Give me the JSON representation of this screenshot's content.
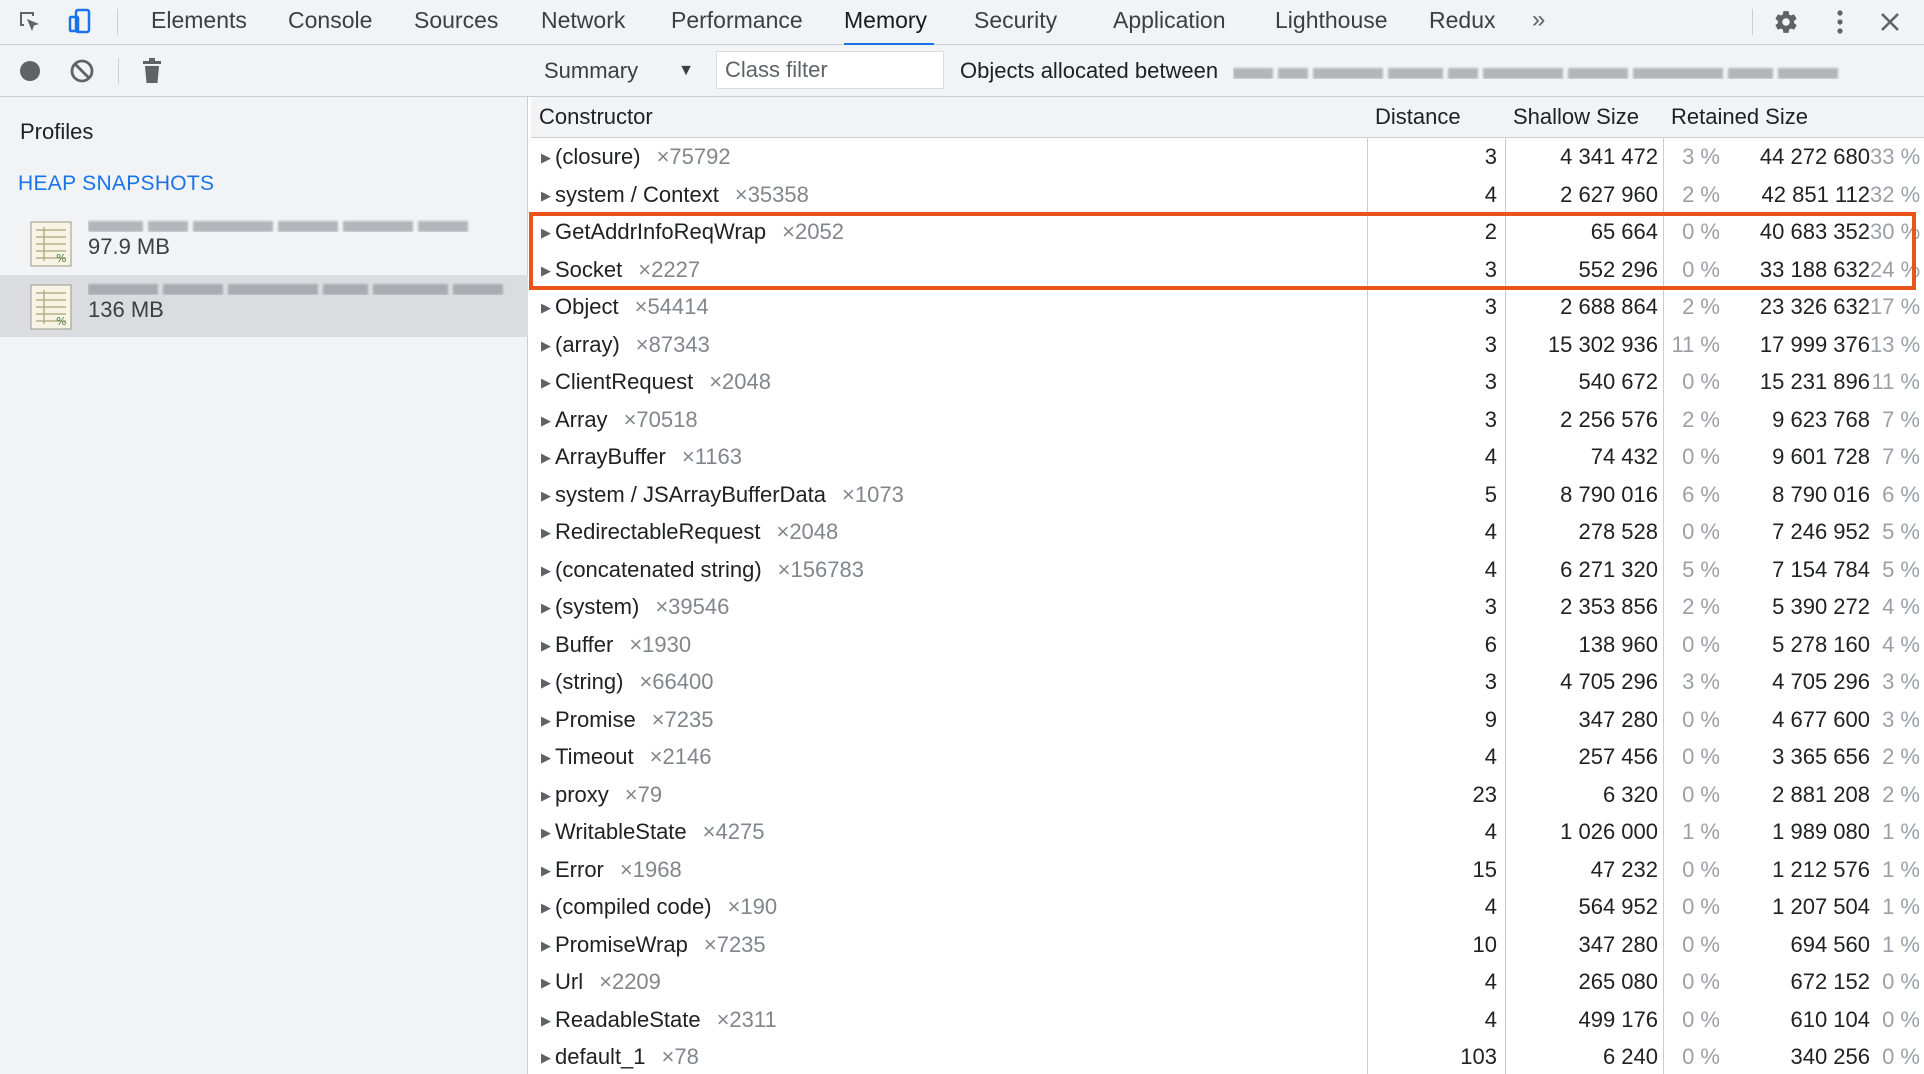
{
  "tabs": [
    {
      "label": "Elements",
      "active": false
    },
    {
      "label": "Console",
      "active": false
    },
    {
      "label": "Sources",
      "active": false
    },
    {
      "label": "Network",
      "active": false
    },
    {
      "label": "Performance",
      "active": false
    },
    {
      "label": "Memory",
      "active": true
    },
    {
      "label": "Security",
      "active": false
    },
    {
      "label": "Application",
      "active": false
    },
    {
      "label": "Lighthouse",
      "active": false
    },
    {
      "label": "Redux",
      "active": false
    }
  ],
  "more_tabs": "»",
  "colors": {
    "accent": "#1a73e8",
    "highlight": "#e8541a"
  },
  "icons": [
    "inspect-element-icon",
    "device-toolbar-icon",
    "record-icon",
    "clear-icon",
    "trash-icon",
    "settings-gear-icon",
    "kebab-menu-icon",
    "close-icon",
    "chevron-right-icon"
  ],
  "sidebar": {
    "title": "Profiles",
    "section": "HEAP SNAPSHOTS",
    "snapshots": [
      {
        "size": "97.9 MB",
        "selected": false
      },
      {
        "size": "136 MB",
        "selected": true
      }
    ]
  },
  "toolbar": {
    "view": "Summary",
    "view_arrow": "▼",
    "class_filter_placeholder": "Class filter",
    "allocated_label": "Objects allocated between"
  },
  "table": {
    "headers": {
      "constructor": "Constructor",
      "distance": "Distance",
      "shallow": "Shallow Size",
      "retained": "Retained Size"
    },
    "rows": [
      {
        "name": "(closure)",
        "count": "×75792",
        "distance": "3",
        "shallow": "4 341 472",
        "shallow_pct": "3 %",
        "retained": "44 272 680",
        "retained_pct": "33 %"
      },
      {
        "name": "system / Context",
        "count": "×35358",
        "distance": "4",
        "shallow": "2 627 960",
        "shallow_pct": "2 %",
        "retained": "42 851 112",
        "retained_pct": "32 %"
      },
      {
        "name": "GetAddrInfoReqWrap",
        "count": "×2052",
        "distance": "2",
        "shallow": "65 664",
        "shallow_pct": "0 %",
        "retained": "40 683 352",
        "retained_pct": "30 %"
      },
      {
        "name": "Socket",
        "count": "×2227",
        "distance": "3",
        "shallow": "552 296",
        "shallow_pct": "0 %",
        "retained": "33 188 632",
        "retained_pct": "24 %"
      },
      {
        "name": "Object",
        "count": "×54414",
        "distance": "3",
        "shallow": "2 688 864",
        "shallow_pct": "2 %",
        "retained": "23 326 632",
        "retained_pct": "17 %"
      },
      {
        "name": "(array)",
        "count": "×87343",
        "distance": "3",
        "shallow": "15 302 936",
        "shallow_pct": "11 %",
        "retained": "17 999 376",
        "retained_pct": "13 %"
      },
      {
        "name": "ClientRequest",
        "count": "×2048",
        "distance": "3",
        "shallow": "540 672",
        "shallow_pct": "0 %",
        "retained": "15 231 896",
        "retained_pct": "11 %"
      },
      {
        "name": "Array",
        "count": "×70518",
        "distance": "3",
        "shallow": "2 256 576",
        "shallow_pct": "2 %",
        "retained": "9 623 768",
        "retained_pct": "7 %"
      },
      {
        "name": "ArrayBuffer",
        "count": "×1163",
        "distance": "4",
        "shallow": "74 432",
        "shallow_pct": "0 %",
        "retained": "9 601 728",
        "retained_pct": "7 %"
      },
      {
        "name": "system / JSArrayBufferData",
        "count": "×1073",
        "distance": "5",
        "shallow": "8 790 016",
        "shallow_pct": "6 %",
        "retained": "8 790 016",
        "retained_pct": "6 %"
      },
      {
        "name": "RedirectableRequest",
        "count": "×2048",
        "distance": "4",
        "shallow": "278 528",
        "shallow_pct": "0 %",
        "retained": "7 246 952",
        "retained_pct": "5 %"
      },
      {
        "name": "(concatenated string)",
        "count": "×156783",
        "distance": "4",
        "shallow": "6 271 320",
        "shallow_pct": "5 %",
        "retained": "7 154 784",
        "retained_pct": "5 %"
      },
      {
        "name": "(system)",
        "count": "×39546",
        "distance": "3",
        "shallow": "2 353 856",
        "shallow_pct": "2 %",
        "retained": "5 390 272",
        "retained_pct": "4 %"
      },
      {
        "name": "Buffer",
        "count": "×1930",
        "distance": "6",
        "shallow": "138 960",
        "shallow_pct": "0 %",
        "retained": "5 278 160",
        "retained_pct": "4 %"
      },
      {
        "name": "(string)",
        "count": "×66400",
        "distance": "3",
        "shallow": "4 705 296",
        "shallow_pct": "3 %",
        "retained": "4 705 296",
        "retained_pct": "3 %"
      },
      {
        "name": "Promise",
        "count": "×7235",
        "distance": "9",
        "shallow": "347 280",
        "shallow_pct": "0 %",
        "retained": "4 677 600",
        "retained_pct": "3 %"
      },
      {
        "name": "Timeout",
        "count": "×2146",
        "distance": "4",
        "shallow": "257 456",
        "shallow_pct": "0 %",
        "retained": "3 365 656",
        "retained_pct": "2 %"
      },
      {
        "name": "proxy",
        "count": "×79",
        "distance": "23",
        "shallow": "6 320",
        "shallow_pct": "0 %",
        "retained": "2 881 208",
        "retained_pct": "2 %"
      },
      {
        "name": "WritableState",
        "count": "×4275",
        "distance": "4",
        "shallow": "1 026 000",
        "shallow_pct": "1 %",
        "retained": "1 989 080",
        "retained_pct": "1 %"
      },
      {
        "name": "Error",
        "count": "×1968",
        "distance": "15",
        "shallow": "47 232",
        "shallow_pct": "0 %",
        "retained": "1 212 576",
        "retained_pct": "1 %"
      },
      {
        "name": "(compiled code)",
        "count": "×190",
        "distance": "4",
        "shallow": "564 952",
        "shallow_pct": "0 %",
        "retained": "1 207 504",
        "retained_pct": "1 %"
      },
      {
        "name": "PromiseWrap",
        "count": "×7235",
        "distance": "10",
        "shallow": "347 280",
        "shallow_pct": "0 %",
        "retained": "694 560",
        "retained_pct": "1 %"
      },
      {
        "name": "Url",
        "count": "×2209",
        "distance": "4",
        "shallow": "265 080",
        "shallow_pct": "0 %",
        "retained": "672 152",
        "retained_pct": "0 %"
      },
      {
        "name": "ReadableState",
        "count": "×2311",
        "distance": "4",
        "shallow": "499 176",
        "shallow_pct": "0 %",
        "retained": "610 104",
        "retained_pct": "0 %"
      },
      {
        "name": "default_1",
        "count": "×78",
        "distance": "103",
        "shallow": "6 240",
        "shallow_pct": "0 %",
        "retained": "340 256",
        "retained_pct": "0 %"
      }
    ]
  }
}
